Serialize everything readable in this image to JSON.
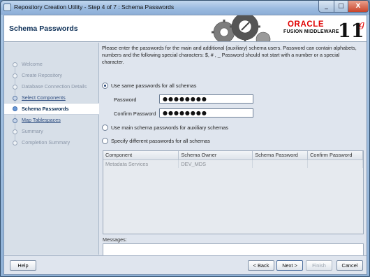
{
  "window": {
    "title": "Repository Creation Utility - Step 4 of 7 : Schema Passwords",
    "controls": {
      "minimize": "_",
      "maximize": "□",
      "close": "X"
    }
  },
  "header": {
    "page_title": "Schema Passwords",
    "brand": {
      "oracle": "ORACLE",
      "product": "FUSION MIDDLEWARE",
      "version": "11",
      "version_suffix": "g"
    }
  },
  "steps": [
    {
      "label": "Welcome",
      "state": "done"
    },
    {
      "label": "Create Repository",
      "state": "done"
    },
    {
      "label": "Database Connection Details",
      "state": "done"
    },
    {
      "label": "Select Components",
      "state": "link"
    },
    {
      "label": "Schema Passwords",
      "state": "current"
    },
    {
      "label": "Map Tablespaces",
      "state": "link"
    },
    {
      "label": "Summary",
      "state": "pending"
    },
    {
      "label": "Completion Summary",
      "state": "pending"
    }
  ],
  "main": {
    "intro": "Please enter the passwords for the main and additional (auxiliary) schema users. Password can contain alphabets, numbers and the following special characters: $, # , _ Password should not start with a number or a special character.",
    "options": {
      "same": "Use same passwords for all schemas",
      "main_aux": "Use main schema passwords for auxiliary schemas",
      "different": "Specify different passwords for all schemas",
      "selected": "same"
    },
    "password_label": "Password",
    "password_value": "●●●●●●●●",
    "confirm_label": "Confirm Password",
    "confirm_value": "●●●●●●●●",
    "table": {
      "headers": [
        "Component",
        "Schema Owner",
        "Schema Password",
        "Confirm Password"
      ],
      "rows": [
        [
          "Metadata Services",
          "DEV_MDS",
          "",
          ""
        ]
      ]
    },
    "messages_label": "Messages:",
    "messages_value": ""
  },
  "footer": {
    "help": "Help",
    "back": "< Back",
    "next": "Next >",
    "finish": "Finish",
    "cancel": "Cancel"
  },
  "colors": {
    "oracle_red": "#e00000",
    "title_navy": "#0b2e56",
    "link_blue": "#2b4a7e"
  }
}
